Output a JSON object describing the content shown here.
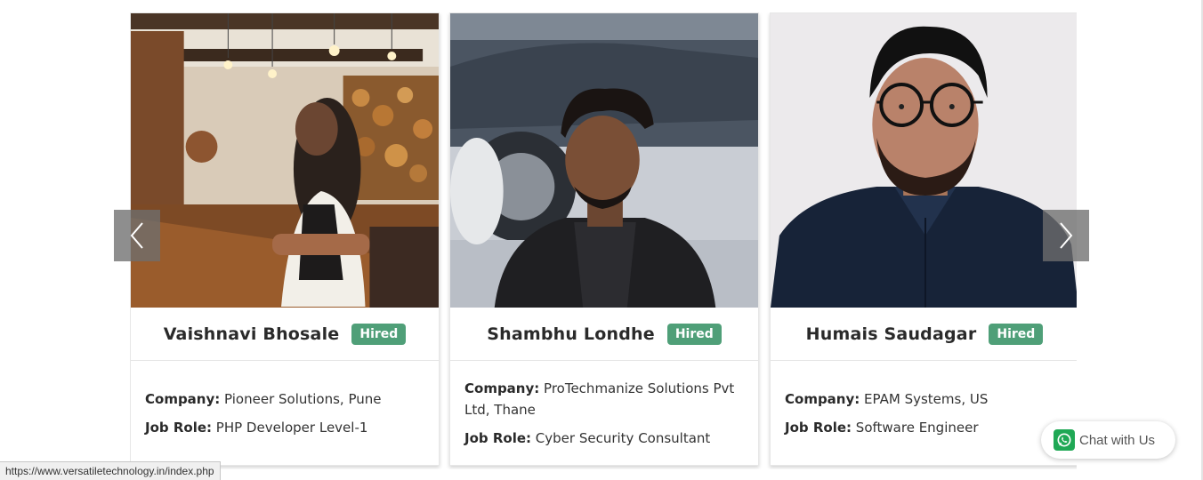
{
  "carousel": {
    "cards": [
      {
        "name": "Vaishnavi Bhosale",
        "badge": "Hired",
        "company_label": "Company:",
        "company": "Pioneer Solutions, Pune",
        "role_label": "Job Role:",
        "role": "PHP Developer Level-1"
      },
      {
        "name": "Shambhu Londhe",
        "badge": "Hired",
        "company_label": "Company:",
        "company": "ProTechmanize Solutions Pvt Ltd, Thane",
        "role_label": "Job Role:",
        "role": "Cyber Security Consultant"
      },
      {
        "name": "Humais Saudagar",
        "badge": "Hired",
        "company_label": "Company:",
        "company": "EPAM Systems, US",
        "role_label": "Job Role:",
        "role": "Software Engineer"
      }
    ],
    "prev_icon": "chevron-left-icon",
    "next_icon": "chevron-right-icon"
  },
  "chat": {
    "label": "Chat with Us",
    "icon": "whatsapp-icon"
  },
  "status_bar": {
    "url": "https://www.versatiletechnology.in/index.php"
  },
  "colors": {
    "badge": "#4f9f78",
    "nav_button": "#6e6e6e",
    "whatsapp": "#1fa855"
  }
}
